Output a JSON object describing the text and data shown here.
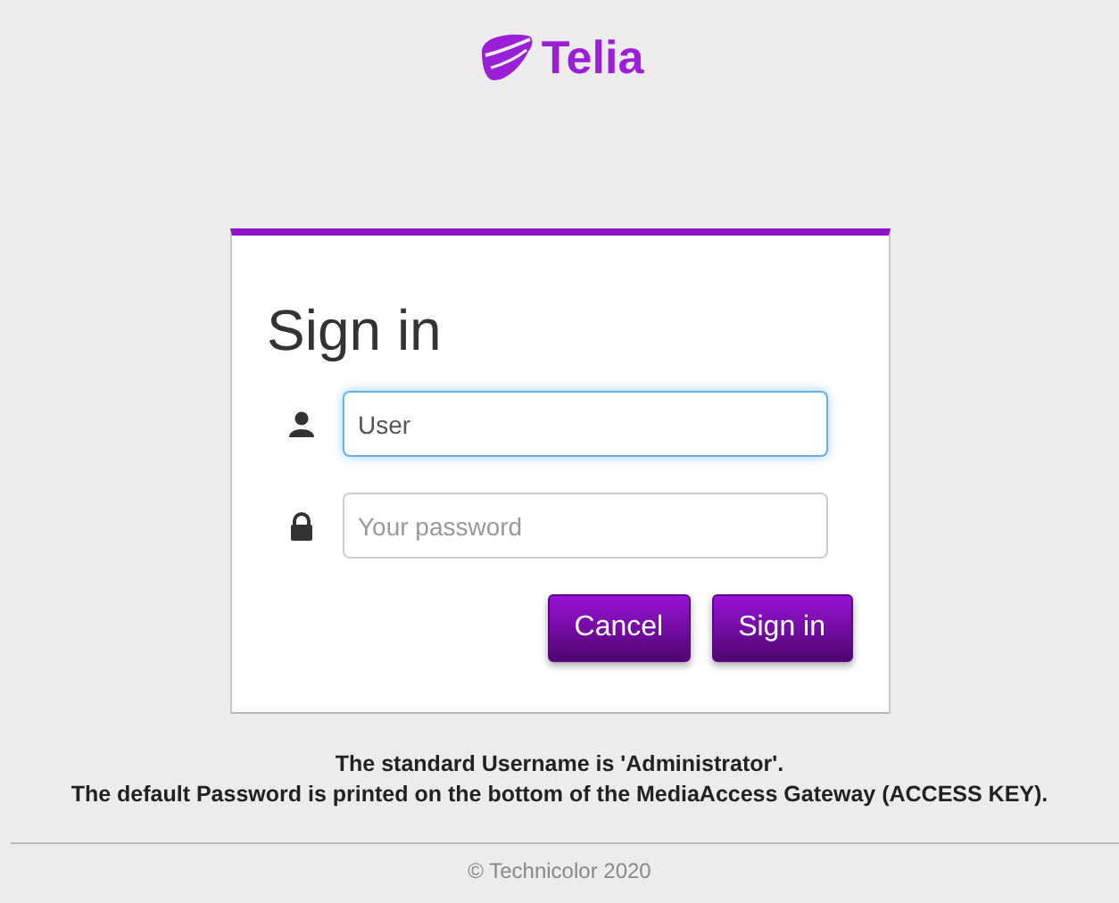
{
  "logo": {
    "text": "Telia"
  },
  "card": {
    "title": "Sign in",
    "fields": [
      {
        "kind": "user",
        "value": "User",
        "focused": true
      },
      {
        "kind": "password",
        "placeholder": "Your password",
        "focused": false
      }
    ],
    "buttons": [
      "Cancel",
      "Sign in"
    ]
  },
  "notes": [
    "The standard Username is 'Administrator'.",
    "The default Password is printed on the bottom of the MediaAccess Gateway (ACCESS KEY)."
  ],
  "footer": "© Technicolor 2020"
}
